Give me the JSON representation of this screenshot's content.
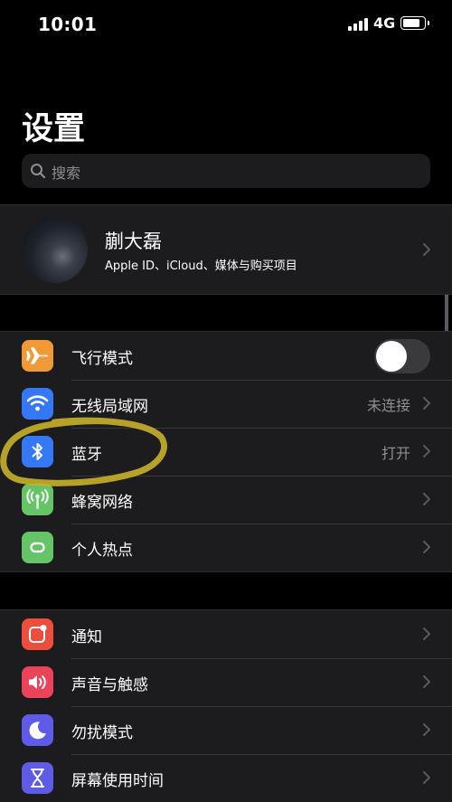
{
  "status_bar": {
    "time": "10:01",
    "network": "4G"
  },
  "page_title": "设置",
  "search": {
    "placeholder": "搜索"
  },
  "profile": {
    "name": "蒯大磊",
    "subtitle": "Apple ID、iCloud、媒体与购买项目"
  },
  "group1": [
    {
      "label": "飞行模式",
      "icon": "airplane-icon",
      "color": "#f09a37",
      "toggle": false
    },
    {
      "label": "无线局域网",
      "icon": "wifi-icon",
      "color": "#3478f6",
      "value": "未连接"
    },
    {
      "label": "蓝牙",
      "icon": "bluetooth-icon",
      "color": "#3478f6",
      "value": "打开"
    },
    {
      "label": "蜂窝网络",
      "icon": "cellular-icon",
      "color": "#65c466"
    },
    {
      "label": "个人热点",
      "icon": "hotspot-icon",
      "color": "#65c466"
    }
  ],
  "group2": [
    {
      "label": "通知",
      "icon": "notifications-icon",
      "color": "#eb4e3d"
    },
    {
      "label": "声音与触感",
      "icon": "sound-icon",
      "color": "#eb445a"
    },
    {
      "label": "勿扰模式",
      "icon": "moon-icon",
      "color": "#5e5ce6"
    },
    {
      "label": "屏幕使用时间",
      "icon": "hourglass-icon",
      "color": "#5e5ce6"
    }
  ],
  "annotation_color": "#c9b12a"
}
